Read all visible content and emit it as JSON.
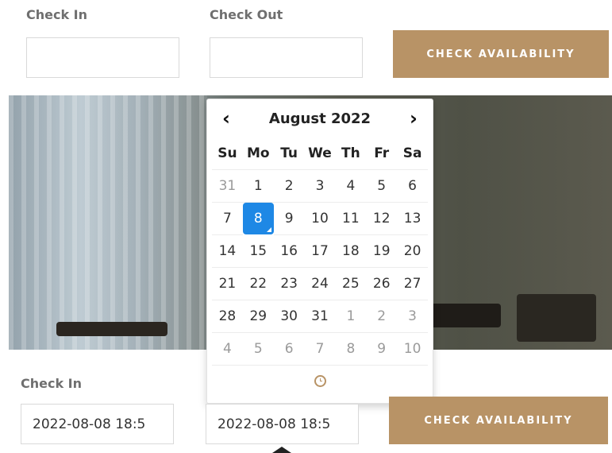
{
  "top_form": {
    "check_in_label": "Check In",
    "check_out_label": "Check Out",
    "check_in_value": "",
    "check_out_value": "",
    "button_label": "CHECK AVAILABILITY"
  },
  "datepicker": {
    "prev_label": "‹",
    "next_label": "›",
    "month_title": "August 2022",
    "weekdays": [
      "Su",
      "Mo",
      "Tu",
      "We",
      "Th",
      "Fr",
      "Sa"
    ],
    "weeks": [
      [
        {
          "d": "31",
          "old": true
        },
        {
          "d": "1"
        },
        {
          "d": "2"
        },
        {
          "d": "3"
        },
        {
          "d": "4"
        },
        {
          "d": "5"
        },
        {
          "d": "6"
        }
      ],
      [
        {
          "d": "7"
        },
        {
          "d": "8",
          "active": true
        },
        {
          "d": "9"
        },
        {
          "d": "10"
        },
        {
          "d": "11"
        },
        {
          "d": "12"
        },
        {
          "d": "13"
        }
      ],
      [
        {
          "d": "14"
        },
        {
          "d": "15"
        },
        {
          "d": "16"
        },
        {
          "d": "17"
        },
        {
          "d": "18"
        },
        {
          "d": "19"
        },
        {
          "d": "20"
        }
      ],
      [
        {
          "d": "21"
        },
        {
          "d": "22"
        },
        {
          "d": "23"
        },
        {
          "d": "24"
        },
        {
          "d": "25"
        },
        {
          "d": "26"
        },
        {
          "d": "27"
        }
      ],
      [
        {
          "d": "28"
        },
        {
          "d": "29"
        },
        {
          "d": "30"
        },
        {
          "d": "31"
        },
        {
          "d": "1",
          "old": true
        },
        {
          "d": "2",
          "old": true
        },
        {
          "d": "3",
          "old": true
        }
      ],
      [
        {
          "d": "4",
          "old": true
        },
        {
          "d": "5",
          "old": true
        },
        {
          "d": "6",
          "old": true
        },
        {
          "d": "7",
          "old": true
        },
        {
          "d": "8",
          "old": true
        },
        {
          "d": "9",
          "old": true
        },
        {
          "d": "10",
          "old": true
        }
      ]
    ],
    "time_icon": "clock-icon",
    "accent_color": "#1e88e5"
  },
  "bottom_form": {
    "check_in_label": "Check In",
    "check_in_value": "2022-08-08 18:5",
    "check_out_value": "2022-08-08 18:5",
    "button_label": "CHECK AVAILABILITY"
  },
  "colors": {
    "button_bg": "#b89366"
  }
}
